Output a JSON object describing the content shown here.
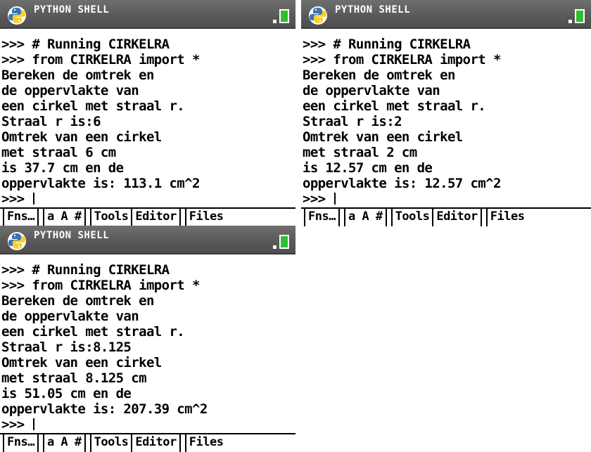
{
  "title": "PYTHON SHELL",
  "menu": [
    "Fns…",
    "a A #",
    "Tools",
    "Editor",
    "Files"
  ],
  "panels": [
    {
      "lines": [
        ">>> # Running CIRKELRA",
        ">>> from CIRKELRA import *",
        "Bereken de omtrek en",
        "de oppervlakte van",
        "een cirkel met straal r.",
        "Straal r is:6",
        "Omtrek van een cirkel",
        "met straal 6 cm",
        "is 37.7 cm en de",
        "oppervlakte is: 113.1 cm^2",
        ">>> "
      ]
    },
    {
      "lines": [
        ">>> # Running CIRKELRA",
        ">>> from CIRKELRA import *",
        "Bereken de omtrek en",
        "de oppervlakte van",
        "een cirkel met straal r.",
        "Straal r is:2",
        "Omtrek van een cirkel",
        "met straal 2 cm",
        "is 12.57 cm en de",
        "oppervlakte is: 12.57 cm^2",
        ">>> "
      ]
    },
    {
      "lines": [
        ">>> # Running CIRKELRA",
        ">>> from CIRKELRA import *",
        "Bereken de omtrek en",
        "de oppervlakte van",
        "een cirkel met straal r.",
        "Straal r is:8.125",
        "Omtrek van een cirkel",
        "met straal 8.125 cm",
        "is 51.05 cm en de",
        "oppervlakte is: 207.39 cm^2",
        ">>> "
      ]
    }
  ],
  "colors": {
    "titlebar": "#5e5e5e",
    "battery": "#2fbf2f",
    "python_blue": "#3b73b4",
    "python_yellow": "#f7cf2f"
  }
}
